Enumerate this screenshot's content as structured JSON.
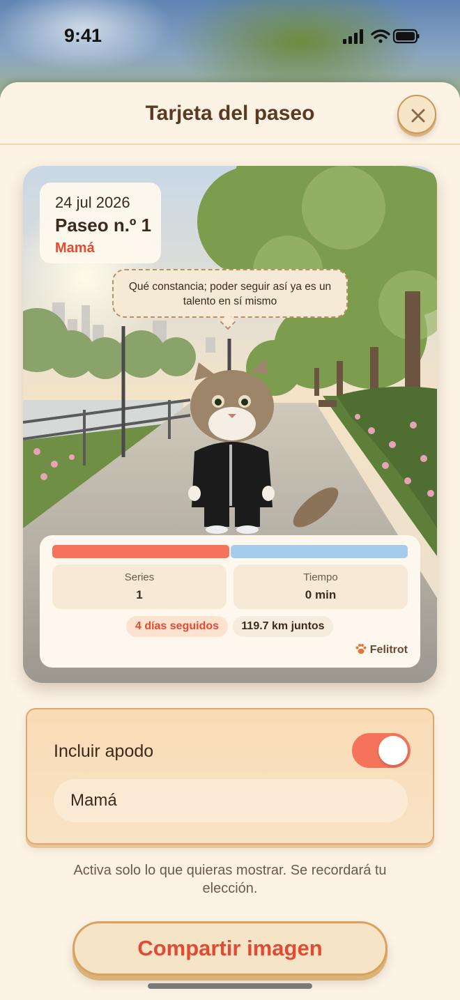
{
  "status_bar": {
    "time": "9:41"
  },
  "sheet": {
    "title": "Tarjeta del paseo"
  },
  "card": {
    "date": "24 jul 2026",
    "walk_number": "Paseo n.º 1",
    "nickname": "Mamá",
    "speech": "Qué constancia; poder seguir así ya es un talento en sí mismo",
    "stats": [
      {
        "label": "Series",
        "value": "1"
      },
      {
        "label": "Tiempo",
        "value": "0 min"
      }
    ],
    "streak": "4 días seguidos",
    "distance": "119.7 km juntos",
    "brand": "Felitrot"
  },
  "settings": {
    "include_nickname_label": "Incluir apodo",
    "include_nickname_on": true,
    "nickname_value": "Mamá"
  },
  "hint": "Activa solo lo que quieras mostrar. Se recordará tu elección.",
  "share_button": "Compartir imagen",
  "colors": {
    "accent": "#f4735a",
    "accent_text": "#e24a33",
    "secondary_bar": "#a6cdee",
    "sheet_bg": "#fcf3e5",
    "title_brown": "#5b3a24"
  },
  "icons": [
    "signal-icon",
    "wifi-icon",
    "battery-icon",
    "close-icon",
    "paw-icon"
  ]
}
